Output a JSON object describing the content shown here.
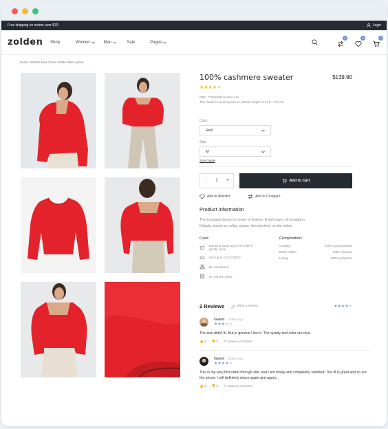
{
  "topbar": {
    "shipping": "Free shipping on orders over $79",
    "login": "Login"
  },
  "nav": {
    "logo": "zolden",
    "items": [
      "Shop",
      "Women",
      "Man",
      "Sale",
      "Pages"
    ],
    "badges": {
      "compare": "0",
      "wishlist": "0",
      "cart": "0"
    }
  },
  "breadcrumb": "Home / What's New / Faux leather biker jacket",
  "product": {
    "title": "100% cashmere sweater",
    "price": "$139.90",
    "rating": 4,
    "ref": "REF: 7706590B-0AH9A-LM",
    "model": "The model is wearing size M | Model height: 5.71 ft / 174 cm",
    "color_label": "Color",
    "color_value": "Red",
    "size_label": "Size",
    "size_value": "M",
    "size_guide": "Size Guide",
    "qty_minus": "−",
    "qty": "1",
    "qty_plus": "+",
    "add_to_cart": "Add to Cart",
    "wishlist": "Add to Wishlist",
    "compare": "Add to Compare",
    "info_title": "Product information",
    "desc1": "The insulated jacket is made of leather. A light layer of insulation.",
    "desc2": "Details: stand-up collar, zipper, two pockets on the sides."
  },
  "care": {
    "title": "Care:",
    "items": [
      {
        "icon": "wash-icon",
        "text1": "Machine wash up to 40°C/86°F",
        "text2": "gentle cycle"
      },
      {
        "icon": "iron-icon",
        "text1": "Iron up to 110°C/230°F",
        "text2": ""
      },
      {
        "icon": "no-bleach-icon",
        "text1": "Do not bleach",
        "text2": ""
      },
      {
        "icon": "no-dry-clean-icon",
        "text1": "Do not dry clean",
        "text2": ""
      }
    ]
  },
  "composition": {
    "title": "Composition:",
    "rows": [
      {
        "k": "Coating:",
        "v": "100% polyurethane"
      },
      {
        "k": "Base Fabric:",
        "v": "100% viscose"
      },
      {
        "k": "Lining:",
        "v": "100% polyester"
      }
    ]
  },
  "reviews": {
    "title": "2 Reviews",
    "write": "Write a review",
    "overall_rating": 4,
    "list": [
      {
        "name": "Guest",
        "date": "3 days ago",
        "rating": 3,
        "text": "The size didn't fit. But in general I like it. The quality and color are nice.",
        "likes": "2",
        "dislikes": "0",
        "comment": "Leave a comment"
      },
      {
        "name": "Guest",
        "date": "9 days ago",
        "rating": 4,
        "text": "This is my very first order through site, and I am totally and completely satisfied! The fit is great and so are the prices. I will definitely return again and again...",
        "likes": "2",
        "dislikes": "0",
        "comment": "Leave a comment"
      }
    ]
  },
  "colors": {
    "accent": "#262a33",
    "star": "#f0b90b",
    "badge": "#6f8fd4",
    "red": "#e0232a"
  }
}
